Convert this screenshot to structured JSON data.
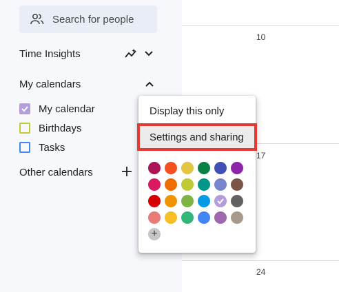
{
  "search": {
    "placeholder": "Search for people"
  },
  "time_insights": {
    "label": "Time Insights"
  },
  "my_calendars": {
    "label": "My calendars",
    "items": [
      {
        "label": "My calendar",
        "color": "#b39ddb",
        "checked": true
      },
      {
        "label": "Birthdays",
        "color": "#c0ca33",
        "checked": false
      },
      {
        "label": "Tasks",
        "color": "#4285f4",
        "checked": false
      }
    ]
  },
  "other_calendars": {
    "label": "Other calendars"
  },
  "grid": {
    "days": [
      "10",
      "17",
      "24"
    ]
  },
  "menu": {
    "display_only": "Display this only",
    "settings_sharing": "Settings and sharing",
    "colors": [
      "#ad1457",
      "#f4511e",
      "#e4c441",
      "#0b8043",
      "#3f51b5",
      "#8e24aa",
      "#d81b60",
      "#ef6c00",
      "#c0ca33",
      "#009688",
      "#7986cb",
      "#795548",
      "#d50000",
      "#f09300",
      "#7cb342",
      "#039be5",
      "#b39ddb",
      "#616161",
      "#e67c73",
      "#f6bf26",
      "#33b679",
      "#4285f4",
      "#9e69af",
      "#a79b8e"
    ],
    "selected_color": "#b39ddb"
  }
}
